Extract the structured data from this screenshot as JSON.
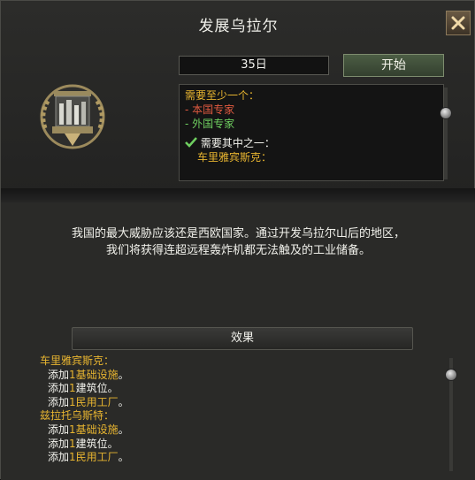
{
  "title": "发展乌拉尔",
  "close_icon": "close-icon",
  "duration": "35日",
  "start_label": "开始",
  "emblem_icon": "factory-emblem-icon",
  "requirements": {
    "need_at_least_one": "需要至少一个：",
    "domestic": "- 本国专家",
    "foreign": "- 外国专家",
    "check_icon": "check-icon",
    "need_one_of": "需要其中之一：",
    "state": "车里雅宾斯克："
  },
  "description_line1": "我国的最大威胁应该还是西欧国家。通过开发乌拉尔山后的地区，",
  "description_line2": "我们将获得连超远程轰炸机都无法触及的工业储备。",
  "effects_label": "效果",
  "effects": [
    {
      "state": "车里雅宾斯克：",
      "lines": [
        {
          "prefix": "添加",
          "num": "1",
          "item": "基础设施",
          "suffix": "。",
          "item_color": "gold"
        },
        {
          "prefix": "添加",
          "num": "1",
          "item": "建筑位",
          "suffix": "。",
          "item_color": "white"
        },
        {
          "prefix": "添加",
          "num": "1",
          "item": "民用工厂",
          "suffix": "。",
          "item_color": "gold"
        }
      ]
    },
    {
      "state": "兹拉托乌斯特：",
      "lines": [
        {
          "prefix": "添加",
          "num": "1",
          "item": "基础设施",
          "suffix": "。",
          "item_color": "gold"
        },
        {
          "prefix": "添加",
          "num": "1",
          "item": "建筑位",
          "suffix": "。",
          "item_color": "white"
        },
        {
          "prefix": "添加",
          "num": "1",
          "item": "民用工厂",
          "suffix": "。",
          "item_color": "gold"
        }
      ]
    }
  ],
  "colors": {
    "gold": "#e8b530",
    "red": "#e05a40",
    "green": "#6fcf60",
    "start_button": "#4c5d44"
  }
}
